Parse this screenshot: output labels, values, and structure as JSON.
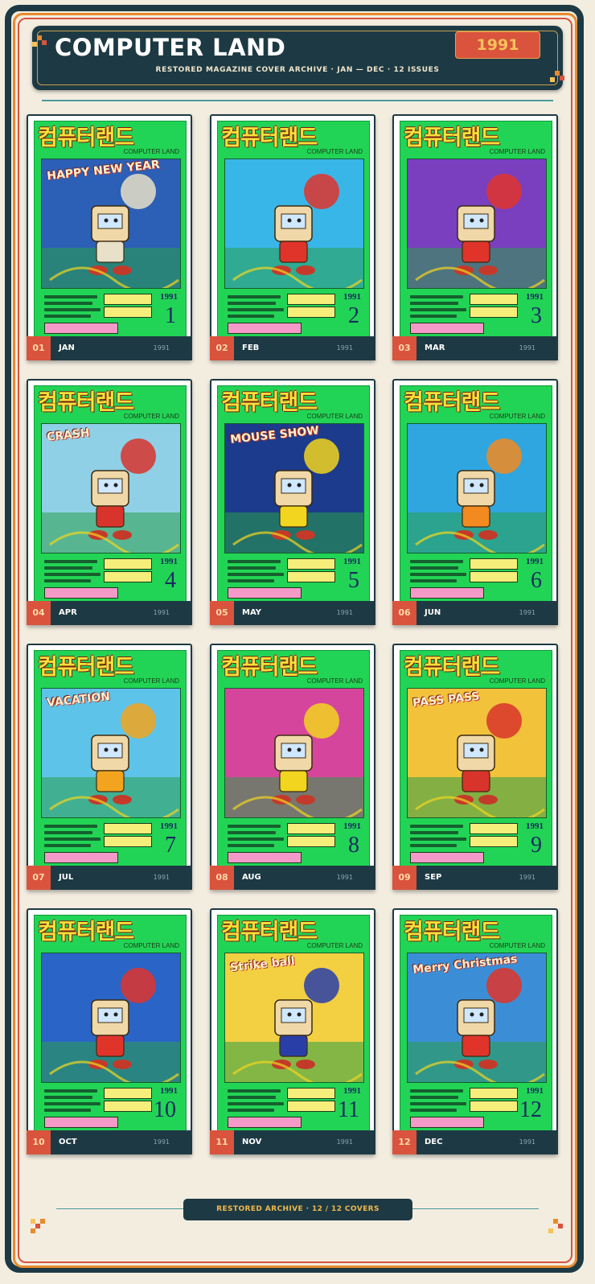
{
  "header": {
    "title": "COMPUTER LAND",
    "subtitle": "RESTORED MAGAZINE COVER ARCHIVE  ·  JAN — DEC  ·  12 ISSUES",
    "year": "1991"
  },
  "footer": {
    "text": "RESTORED ARCHIVE  ·  12 / 12 COVERS"
  },
  "cover_common": {
    "logo": "컴퓨터랜드",
    "logo_sub": "COMPUTER LAND",
    "year": "1991"
  },
  "colors": {
    "navy": "#1d3a44",
    "accent_red": "#d9533d",
    "accent_orange": "#e98a2d",
    "cover_green": "#22d455",
    "logo_yellow": "#f4e13a"
  },
  "issues": [
    {
      "num": "01",
      "month": "JAN",
      "year": "1991",
      "issue": "1",
      "art_bg": "#2c5fb6",
      "art_accent": "#e8e0c8",
      "cover_word": "HAPPY NEW YEAR"
    },
    {
      "num": "02",
      "month": "FEB",
      "year": "1991",
      "issue": "2",
      "art_bg": "#39b6e8",
      "art_accent": "#e0342b",
      "cover_word": ""
    },
    {
      "num": "03",
      "month": "MAR",
      "year": "1991",
      "issue": "3",
      "art_bg": "#7a3fbf",
      "art_accent": "#e0342b",
      "cover_word": ""
    },
    {
      "num": "04",
      "month": "APR",
      "year": "1991",
      "issue": "4",
      "art_bg": "#8fd0e6",
      "art_accent": "#d8342b",
      "cover_word": "CRASH"
    },
    {
      "num": "05",
      "month": "MAY",
      "year": "1991",
      "issue": "5",
      "art_bg": "#1c3b8c",
      "art_accent": "#f2d51f",
      "cover_word": "MOUSE SHOW"
    },
    {
      "num": "06",
      "month": "JUN",
      "year": "1991",
      "issue": "6",
      "art_bg": "#2fa6e0",
      "art_accent": "#f28a1f",
      "cover_word": ""
    },
    {
      "num": "07",
      "month": "JUL",
      "year": "1991",
      "issue": "7",
      "art_bg": "#5ec3e8",
      "art_accent": "#f2a41f",
      "cover_word": "VACATION"
    },
    {
      "num": "08",
      "month": "AUG",
      "year": "1991",
      "issue": "8",
      "art_bg": "#d6459c",
      "art_accent": "#f2d51f",
      "cover_word": ""
    },
    {
      "num": "09",
      "month": "SEP",
      "year": "1991",
      "issue": "9",
      "art_bg": "#f2c23a",
      "art_accent": "#d8342b",
      "cover_word": "PASS PASS"
    },
    {
      "num": "10",
      "month": "OCT",
      "year": "1991",
      "issue": "10",
      "art_bg": "#2a64c6",
      "art_accent": "#e0342b",
      "cover_word": ""
    },
    {
      "num": "11",
      "month": "NOV",
      "year": "1991",
      "issue": "11",
      "art_bg": "#f2d042",
      "art_accent": "#2a3ea8",
      "cover_word": "Strike ball"
    },
    {
      "num": "12",
      "month": "DEC",
      "year": "1991",
      "issue": "12",
      "art_bg": "#3b8ed6",
      "art_accent": "#e0342b",
      "cover_word": "Merry Christmas"
    }
  ]
}
